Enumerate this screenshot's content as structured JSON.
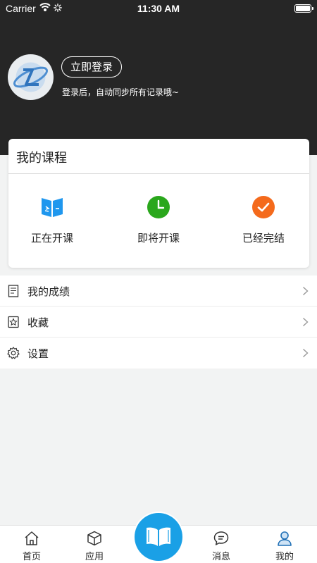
{
  "status_bar": {
    "carrier": "Carrier",
    "time": "11:30 AM"
  },
  "profile": {
    "login_button": "立即登录",
    "hint": "登录后，自动同步所有记录哦~"
  },
  "courses": {
    "title": "我的课程",
    "items": [
      {
        "label": "正在开课",
        "icon": "book-icon",
        "color": "#1f97ee"
      },
      {
        "label": "即将开课",
        "icon": "clock-icon",
        "color": "#2aa71c"
      },
      {
        "label": "已经完结",
        "icon": "check-icon",
        "color": "#f46a1c"
      }
    ]
  },
  "menu": [
    {
      "label": "我的成绩",
      "icon": "report-icon"
    },
    {
      "label": "收藏",
      "icon": "star-icon"
    },
    {
      "label": "设置",
      "icon": "gear-icon"
    }
  ],
  "tabbar": {
    "items": [
      {
        "label": "首页",
        "icon": "home-icon"
      },
      {
        "label": "应用",
        "icon": "cube-icon"
      },
      {
        "label": "消息",
        "icon": "message-icon"
      },
      {
        "label": "我的",
        "icon": "user-icon"
      }
    ],
    "center_icon": "open-book-icon",
    "accent": "#1aa0e6"
  }
}
